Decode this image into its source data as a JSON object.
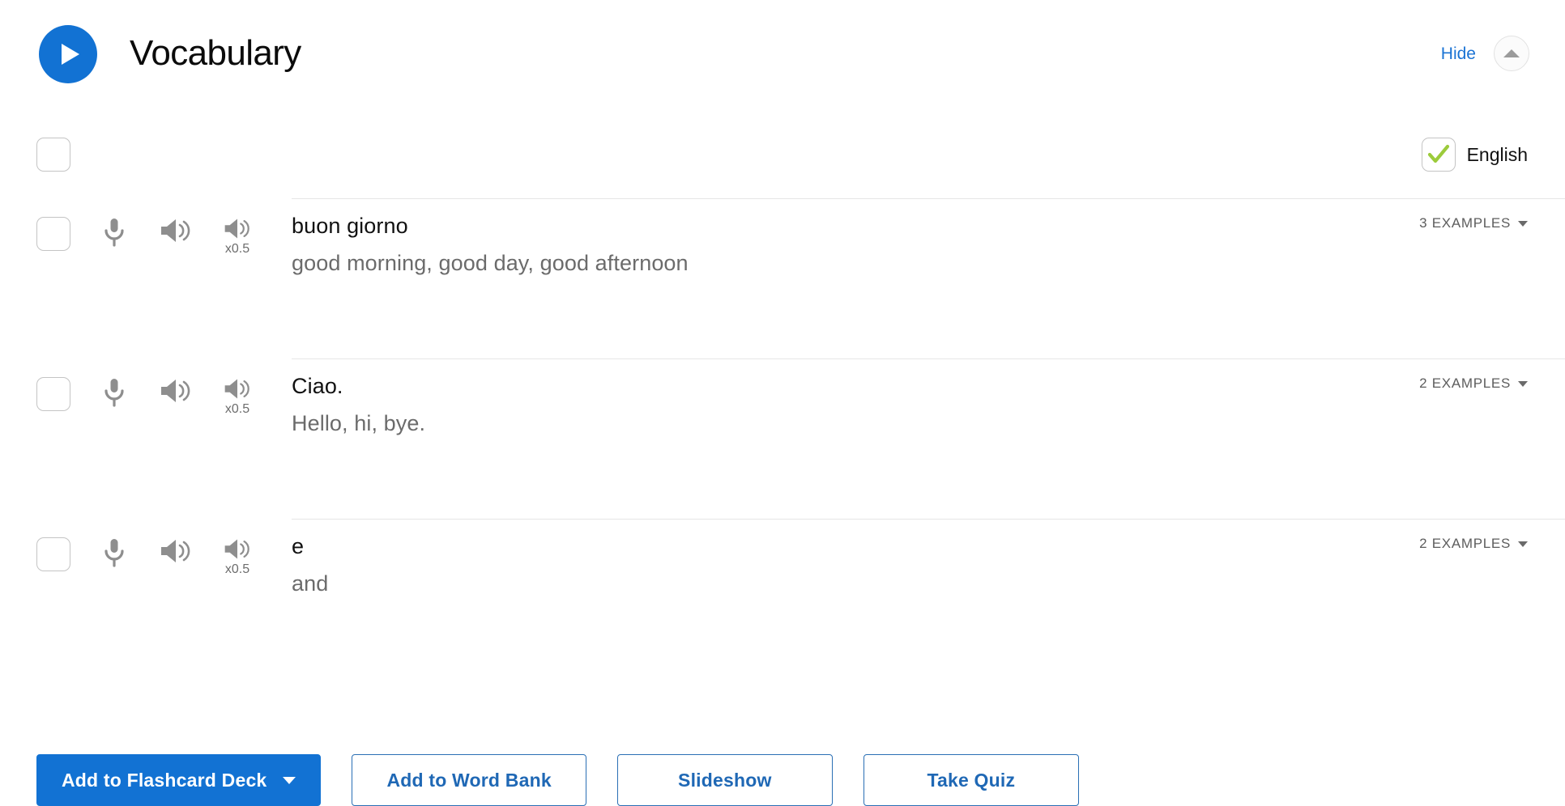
{
  "header": {
    "title": "Vocabulary",
    "play_icon": "play-icon",
    "hide_label": "Hide",
    "collapse_icon": "chevron-up-icon"
  },
  "toolbar": {
    "select_all_checkbox": "unchecked",
    "language_label": "English",
    "language_checked": true,
    "language_check_color": "#9ccb3b"
  },
  "row_icons": {
    "mic": "microphone-icon",
    "speaker": "speaker-icon",
    "speaker_slow": "speaker-slow-icon",
    "speed_label": "x0.5"
  },
  "vocab_rows": [
    {
      "term": "buon giorno",
      "definition": "good morning, good day, good afternoon",
      "examples_label": "3 EXAMPLES",
      "checked": false
    },
    {
      "term": "Ciao.",
      "definition": "Hello, hi, bye.",
      "examples_label": "2 EXAMPLES",
      "checked": false
    },
    {
      "term": "e",
      "definition": "and",
      "examples_label": "2 EXAMPLES",
      "checked": false
    }
  ],
  "actions": {
    "flashcard_label": "Add to Flashcard Deck",
    "word_bank_label": "Add to Word Bank",
    "slideshow_label": "Slideshow",
    "quiz_label": "Take Quiz"
  },
  "colors": {
    "accent_blue": "#1272d3",
    "link_blue": "#1a73d4",
    "outline_blue": "#2a6fb5",
    "green_check": "#9ccb3b",
    "icon_gray": "#8e8e8e",
    "divider": "#e6e6e6"
  }
}
